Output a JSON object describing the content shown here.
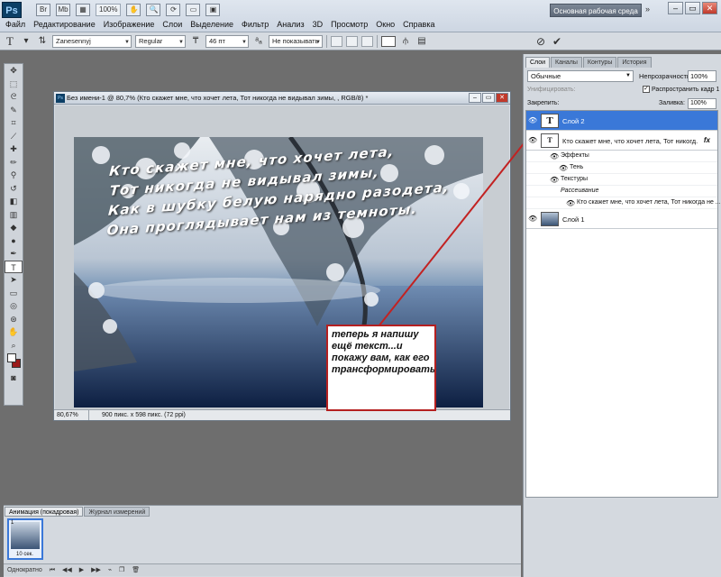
{
  "menubar": {
    "app_logo": "Ps",
    "zoom": "100%",
    "items": [
      "Файл",
      "Редактирование",
      "Изображение",
      "Слои",
      "Выделение",
      "Фильтр",
      "Анализ",
      "3D",
      "Просмотр",
      "Окно",
      "Справка"
    ],
    "workspace": "Основная рабочая среда"
  },
  "options": {
    "font_family": "Zanesennyj",
    "font_style": "Regular",
    "font_size": "46 пт",
    "antialias": "Не показывать"
  },
  "document": {
    "title": "Без имени-1 @ 80,7% (Кто скажет мне, что хочет лета,   Тот никогда не видывал зимы, , RGB/8) *",
    "zoom": "80,67%",
    "info": "900 пикс. x 598 пикс. (72 ppi)",
    "poem": [
      "Кто скажет мне, что хочет лета,",
      "Тот никогда не видывал зимы,",
      "Как в шубку белую нарядно разодета,",
      "Она проглядывает нам из темноты."
    ]
  },
  "callout": {
    "text": "теперь я напишу ещё текст...и покажу вам, как его трансформировать"
  },
  "layers_panel": {
    "tabs": [
      "Слои",
      "Каналы",
      "Контуры",
      "История"
    ],
    "blend_mode": "Обычные",
    "opacity_label": "Непрозрачность:",
    "opacity": "100%",
    "unify_label": "Унифицировать:",
    "propagate_label": "Распространить кадр 1",
    "lock_label": "Закрепить:",
    "fill_label": "Заливка:",
    "fill": "100%",
    "layers": [
      {
        "name": "Слой 2"
      },
      {
        "name": "Кто скажет мне, что хочет лета,   Тот никогд..."
      },
      {
        "name": "Слой 1"
      }
    ],
    "effects_label": "Эффекты",
    "shadow_label": "Тень",
    "textures_label": "Текстуры",
    "scatter_label": "Рассеивание",
    "scatter_item": "Кто скажет мне, что хочет лета,   Тот никогда не ..."
  },
  "animation": {
    "tabs": [
      "Анимация (покадровая)",
      "Журнал измерений"
    ],
    "frame_number": "1",
    "frame_time": "10 сек.",
    "loop": "Однократно"
  }
}
